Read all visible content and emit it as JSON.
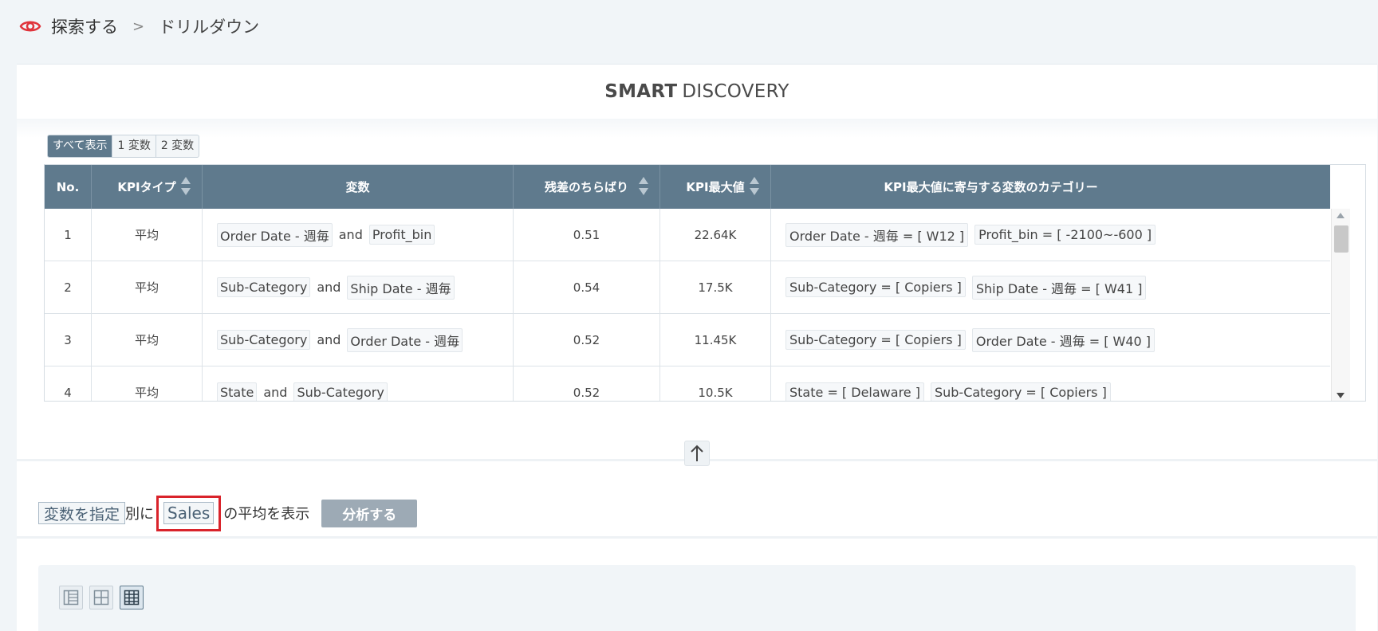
{
  "breadcrumb": {
    "explore": "探索する",
    "separator": ">",
    "current": "ドリルダウン"
  },
  "panel": {
    "title_bold": "SMART",
    "title_rest": "DISCOVERY"
  },
  "filters": [
    "すべて表示",
    "1 変数",
    "2 変数"
  ],
  "table": {
    "headers": [
      "No.",
      "KPIタイプ",
      "変数",
      "残差のちらばり",
      "KPI最大値",
      "KPI最大値に寄与する変数のカテゴリー"
    ],
    "rows": [
      {
        "no": "1",
        "kpi_type": "平均",
        "var1": "Order Date - 週毎",
        "and": "and",
        "var2": "Profit_bin",
        "residual": "0.51",
        "kpi_max": "22.64K",
        "cat1": "Order Date - 週毎 = [ W12 ]",
        "cat2": "Profit_bin = [ -2100~-600 ]"
      },
      {
        "no": "2",
        "kpi_type": "平均",
        "var1": "Sub-Category",
        "and": "and",
        "var2": "Ship Date - 週毎",
        "residual": "0.54",
        "kpi_max": "17.5K",
        "cat1": "Sub-Category = [ Copiers ]",
        "cat2": "Ship Date - 週毎 = [ W41 ]"
      },
      {
        "no": "3",
        "kpi_type": "平均",
        "var1": "Sub-Category",
        "and": "and",
        "var2": "Order Date - 週毎",
        "residual": "0.52",
        "kpi_max": "11.45K",
        "cat1": "Sub-Category = [ Copiers ]",
        "cat2": "Order Date - 週毎 = [ W40 ]"
      },
      {
        "no": "4",
        "kpi_type": "平均",
        "var1": "State",
        "and": "and",
        "var2": "Sub-Category",
        "residual": "0.52",
        "kpi_max": "10.5K",
        "cat1": "State = [ Delaware ]",
        "cat2": "Sub-Category = [ Copiers ]"
      }
    ]
  },
  "analysis": {
    "variable_button": "変数を指定",
    "by_text": "別に",
    "kpi_field": "Sales",
    "suffix_text": "の平均を表示",
    "analyze_button": "分析する"
  },
  "colors": {
    "header_bg": "#5f7a8d",
    "highlight": "#d9232b",
    "eye_icon": "#e0343c",
    "analyze_bg": "#9daab5"
  }
}
